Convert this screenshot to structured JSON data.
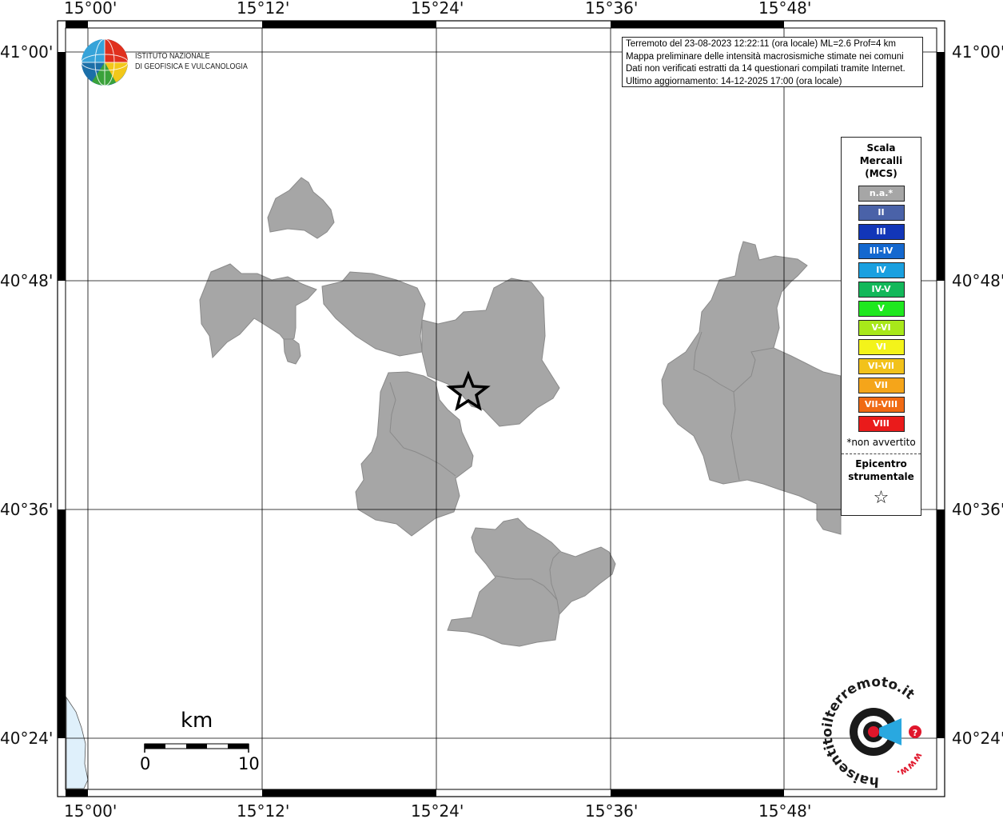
{
  "map": {
    "lon_labels": [
      "15°00'",
      "15°12'",
      "15°24'",
      "15°36'",
      "15°48'"
    ],
    "lat_labels": [
      "41°00'",
      "40°48'",
      "40°36'",
      "40°24'"
    ],
    "info_lines": [
      "Terremoto del 23-08-2023 12:22:11 (ora locale) ML=2.6 Prof=4 km",
      "Mappa preliminare delle intensità macrosismiche stimate nei comuni",
      "Dati non verificati estratti da 14 questionari compilati tramite Internet.",
      "Ultimo aggiornamento: 14-12-2025 17:00 (ora locale)"
    ],
    "region_fill": "#a6a6a6",
    "sea_fill": "#dff0fb"
  },
  "logo": {
    "line1": "ISTITUTO NAZIONALE",
    "line2": "DI GEOFISICA E VULCANOLOGIA"
  },
  "legend": {
    "title_lines": [
      "Scala",
      "Mercalli",
      "(MCS)"
    ],
    "items": [
      {
        "label": "n.a.*",
        "color": "#a6a6a6"
      },
      {
        "label": "II",
        "color": "#4a62a8"
      },
      {
        "label": "III",
        "color": "#1236b8"
      },
      {
        "label": "III-IV",
        "color": "#1468cf"
      },
      {
        "label": "IV",
        "color": "#1aa0e0"
      },
      {
        "label": "IV-V",
        "color": "#13b85a"
      },
      {
        "label": "V",
        "color": "#1fe81f"
      },
      {
        "label": "V-VI",
        "color": "#a8e81a"
      },
      {
        "label": "VI",
        "color": "#f3f31a"
      },
      {
        "label": "VI-VII",
        "color": "#f2c21a"
      },
      {
        "label": "VII",
        "color": "#f5a51a"
      },
      {
        "label": "VII-VIII",
        "color": "#f06a14"
      },
      {
        "label": "VIII",
        "color": "#ea1b1b"
      }
    ],
    "note": "*non avvertito",
    "epicenter_lines": [
      "Epicentro",
      "strumentale"
    ],
    "epicenter_icon": "star-icon"
  },
  "scalebar": {
    "unit": "km",
    "start": "0",
    "end": "10"
  },
  "badge": {
    "text": "haisentitoilterremoto.it",
    "www": "www."
  }
}
